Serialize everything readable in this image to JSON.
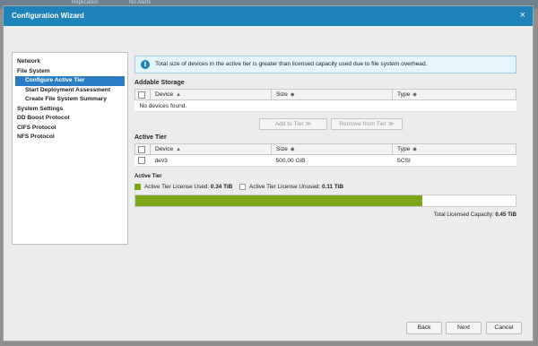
{
  "background": {
    "col1": "Replication",
    "col2": "No Alerts"
  },
  "dialog": {
    "title": "Configuration Wizard",
    "close_glyph": "×"
  },
  "nav": {
    "items": [
      {
        "label": "Network",
        "level": 1,
        "selected": false
      },
      {
        "label": "File System",
        "level": 1,
        "selected": false
      },
      {
        "label": "Configure Active Tier",
        "level": 2,
        "selected": true
      },
      {
        "label": "Start Deployment Assessment",
        "level": 2,
        "selected": false
      },
      {
        "label": "Create File System Summary",
        "level": 2,
        "selected": false
      },
      {
        "label": "System Settings",
        "level": 1,
        "selected": false
      },
      {
        "label": "DD Boost Protocol",
        "level": 1,
        "selected": false
      },
      {
        "label": "CIFS Protocol",
        "level": 1,
        "selected": false
      },
      {
        "label": "NFS Protocol",
        "level": 1,
        "selected": false
      }
    ]
  },
  "info": {
    "icon": "info-icon",
    "glyph": "i",
    "message": "Total size of devices in the active tier is greater than licensed capacity used due to file system overhead."
  },
  "addable_storage": {
    "title": "Addable Storage",
    "headers": {
      "device": "Device",
      "size": "Size",
      "type": "Type"
    },
    "empty_message": "No devices found."
  },
  "actions": {
    "add": "Add to Tier ≫",
    "remove": "Remove from Tier ≫"
  },
  "active_tier": {
    "title": "Active Tier",
    "headers": {
      "device": "Device",
      "size": "Size",
      "type": "Type"
    },
    "rows": [
      {
        "device": "dev3",
        "size": "500.00 GiB",
        "type": "SCSI"
      }
    ]
  },
  "capacity": {
    "label": "Active Tier",
    "used_label": "Active Tier License Used:",
    "used_value": "0.34 TiB",
    "unused_label": "Active Tier License Unused:",
    "unused_value": "0.11 TiB",
    "used_fraction": 0.755,
    "total_label": "Total Licensed Capacity:",
    "total_value": "0.45 TiB",
    "used_color": "#7aa617"
  },
  "footer": {
    "back": "Back",
    "next": "Next",
    "cancel": "Cancel"
  },
  "colors": {
    "accent": "#1d83b8",
    "selection": "#2a7dc2"
  },
  "sort_glyphs": {
    "asc": "▲",
    "both": "◆"
  }
}
